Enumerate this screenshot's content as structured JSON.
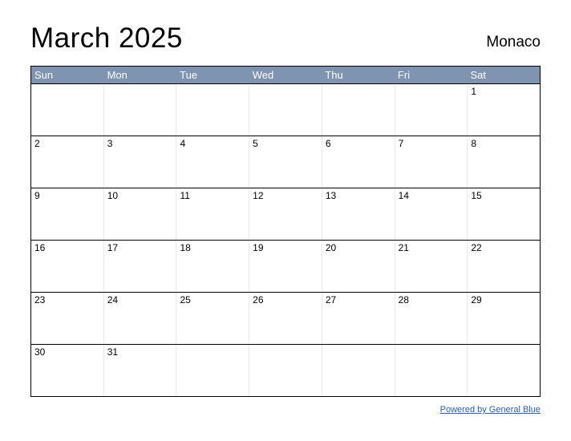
{
  "title": "March 2025",
  "region": "Monaco",
  "dow": [
    "Sun",
    "Mon",
    "Tue",
    "Wed",
    "Thu",
    "Fri",
    "Sat"
  ],
  "weeks": [
    [
      "",
      "",
      "",
      "",
      "",
      "",
      "1"
    ],
    [
      "2",
      "3",
      "4",
      "5",
      "6",
      "7",
      "8"
    ],
    [
      "9",
      "10",
      "11",
      "12",
      "13",
      "14",
      "15"
    ],
    [
      "16",
      "17",
      "18",
      "19",
      "20",
      "21",
      "22"
    ],
    [
      "23",
      "24",
      "25",
      "26",
      "27",
      "28",
      "29"
    ],
    [
      "30",
      "31",
      "",
      "",
      "",
      "",
      ""
    ]
  ],
  "footer_link": "Powered by General Blue"
}
